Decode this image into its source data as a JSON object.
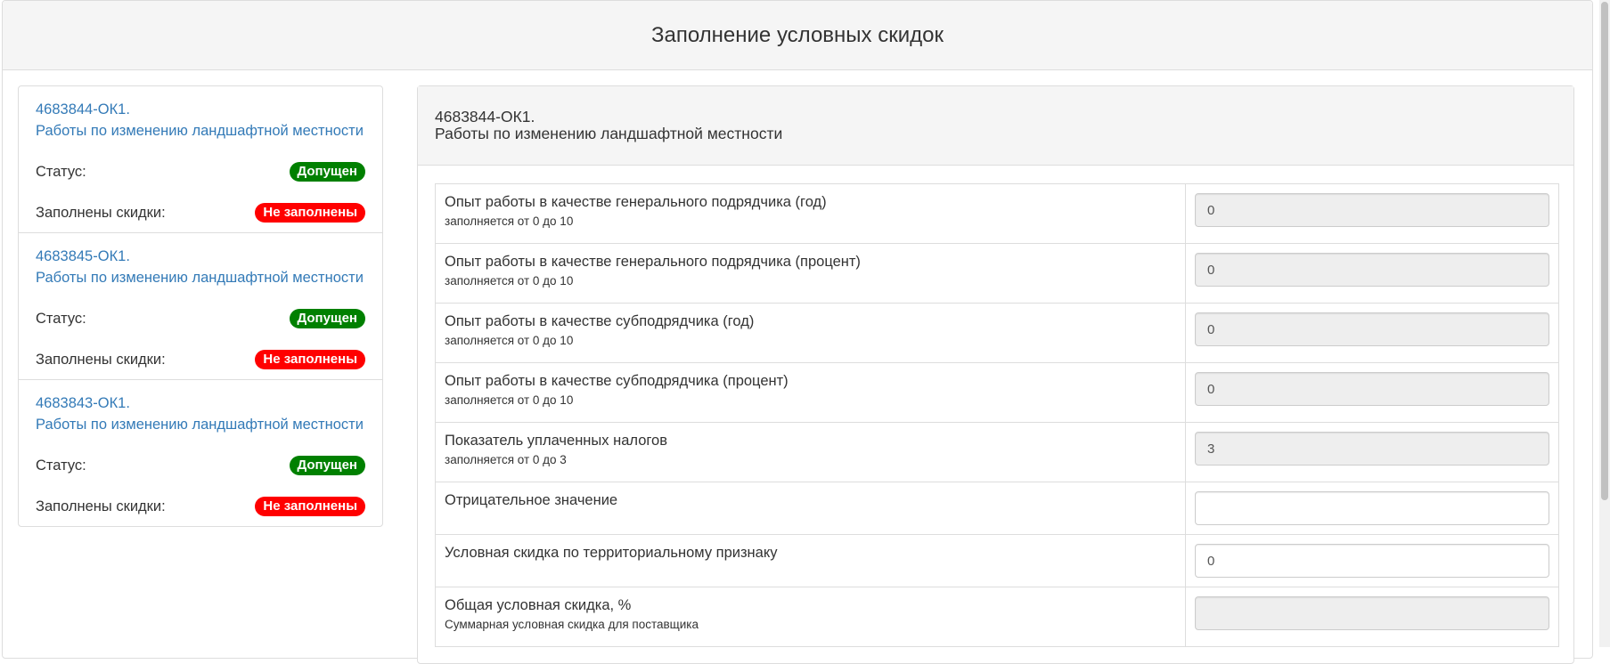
{
  "page": {
    "title": "Заполнение условных скидок"
  },
  "tenders": [
    {
      "code": "4683844-ОК1.",
      "name": "Работы по изменению ландшафтной местности",
      "status_label": "Статус:",
      "status_value": "Допущен",
      "discount_label": "Заполнены скидки:",
      "discount_value": "Не заполнены"
    },
    {
      "code": "4683845-ОК1.",
      "name": "Работы по изменению ландшафтной местности",
      "status_label": "Статус:",
      "status_value": "Допущен",
      "discount_label": "Заполнены скидки:",
      "discount_value": "Не заполнены"
    },
    {
      "code": "4683843-ОК1.",
      "name": "Работы по изменению ландшафтной местности",
      "status_label": "Статус:",
      "status_value": "Допущен",
      "discount_label": "Заполнены скидки:",
      "discount_value": "Не заполнены"
    }
  ],
  "detail": {
    "code": "4683844-ОК1.",
    "name": "Работы по изменению ландшафтной местности",
    "fields": [
      {
        "label": "Опыт работы в качестве генерального подрядчика (год)",
        "hint": "заполняется от 0 до 10",
        "value": "0",
        "readonly": true
      },
      {
        "label": "Опыт работы в качестве генерального подрядчика (процент)",
        "hint": "заполняется от 0 до 10",
        "value": "0",
        "readonly": true
      },
      {
        "label": "Опыт работы в качестве субподрядчика (год)",
        "hint": "заполняется от 0 до 10",
        "value": "0",
        "readonly": true
      },
      {
        "label": "Опыт работы в качестве субподрядчика (процент)",
        "hint": "заполняется от 0 до 10",
        "value": "0",
        "readonly": true
      },
      {
        "label": "Показатель уплаченных налогов",
        "hint": "заполняется от 0 до 3",
        "value": "3",
        "readonly": true
      },
      {
        "label": "Отрицательное значение",
        "hint": "",
        "value": "",
        "readonly": false
      },
      {
        "label": "Условная скидка по территориальному признаку",
        "hint": "",
        "value": "0",
        "readonly": false
      },
      {
        "label": "Общая условная скидка, %",
        "hint": "Суммарная условная скидка для поставщика",
        "value": "",
        "readonly": true
      }
    ]
  },
  "colors": {
    "link": "#337ab7",
    "status_ok": "#008000",
    "status_bad": "#ff0000",
    "panel_heading": "#f5f5f5",
    "readonly_input": "#eeeeee"
  }
}
